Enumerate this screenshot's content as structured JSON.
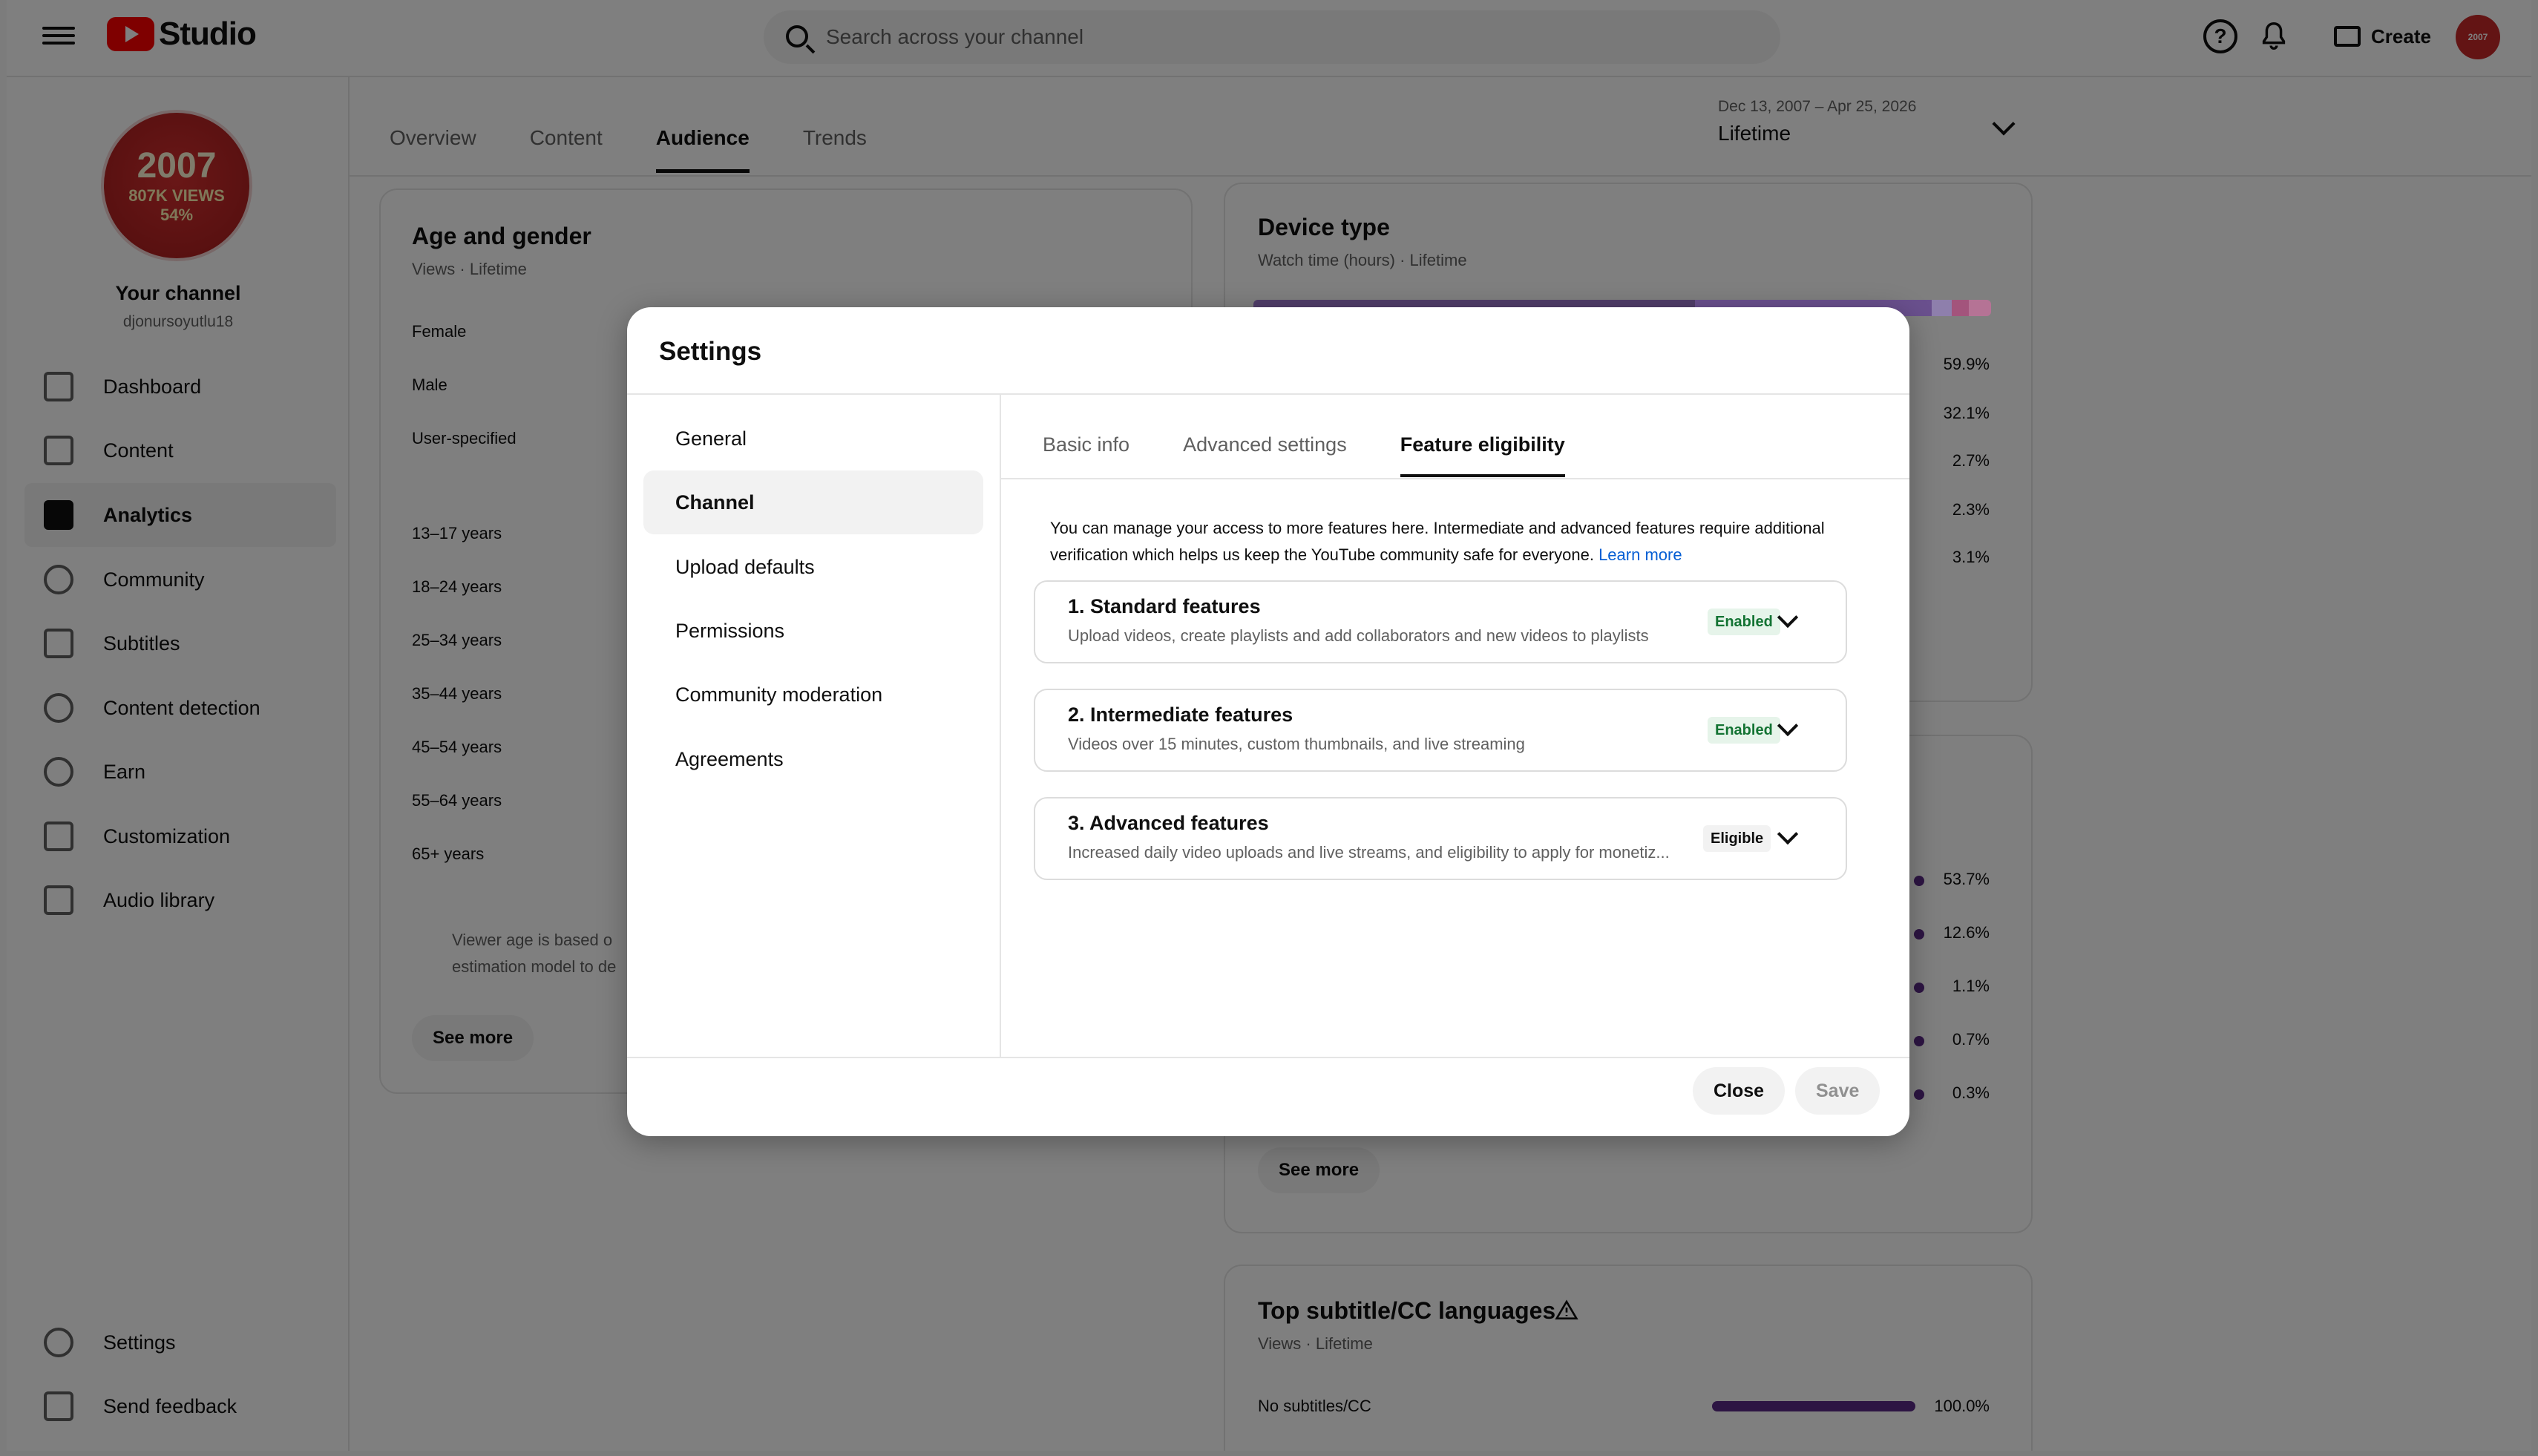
{
  "header": {
    "app_name": "Studio",
    "search_placeholder": "Search across your channel",
    "create_label": "Create",
    "avatar_text": "2007"
  },
  "sidebar": {
    "avatar": {
      "line1": "2007",
      "line2": "807K VIEWS",
      "line3": "54%"
    },
    "channel_name": "Your channel",
    "channel_handle": "djonursoyutlu18",
    "items": [
      {
        "label": "Dashboard",
        "icon": "dashboard-icon"
      },
      {
        "label": "Content",
        "icon": "content-icon"
      },
      {
        "label": "Analytics",
        "icon": "analytics-icon",
        "active": true
      },
      {
        "label": "Community",
        "icon": "community-icon"
      },
      {
        "label": "Subtitles",
        "icon": "subtitles-icon"
      },
      {
        "label": "Content detection",
        "icon": "copyright-icon"
      },
      {
        "label": "Earn",
        "icon": "dollar-icon"
      },
      {
        "label": "Customization",
        "icon": "magic-wand-icon"
      },
      {
        "label": "Audio library",
        "icon": "audio-library-icon"
      }
    ],
    "bottom": [
      {
        "label": "Settings",
        "icon": "gear-icon"
      },
      {
        "label": "Send feedback",
        "icon": "feedback-icon"
      }
    ]
  },
  "analytics": {
    "tabs": [
      "Overview",
      "Content",
      "Audience",
      "Trends"
    ],
    "active_tab": "Audience",
    "date_range": {
      "dates": "Dec 13, 2007 – Apr 25, 2026",
      "label": "Lifetime"
    },
    "age_gender": {
      "title": "Age and gender",
      "subtitle": "Views · Lifetime",
      "genders": [
        "Female",
        "Male",
        "User-specified"
      ],
      "ages": [
        "13–17 years",
        "18–24 years",
        "25–34 years",
        "35–44 years",
        "45–54 years",
        "55–64 years",
        "65+ years"
      ],
      "note": "Viewer age is based o",
      "note2": "estimation model to de",
      "see_more": "See more"
    },
    "device_type": {
      "title": "Device type",
      "subtitle": "Watch time (hours) · Lifetime",
      "percents": [
        "59.9%",
        "32.1%",
        "2.7%",
        "2.3%",
        "3.1%"
      ],
      "bar_colors": [
        "#2d0a5a",
        "#5a2a9c",
        "#9b7fd1",
        "#c2327a",
        "#e26aa8"
      ]
    },
    "second_card": {
      "percents": [
        "53.7%",
        "12.6%",
        "1.1%",
        "0.7%",
        "0.3%"
      ],
      "see_more": "See more"
    },
    "subtitle_langs": {
      "title": "Top subtitle/CC languages",
      "subtitle": "Views · Lifetime",
      "rows": [
        {
          "label": "No subtitles/CC",
          "value": "100.0%",
          "fraction": 1.0
        }
      ]
    }
  },
  "dialog": {
    "title": "Settings",
    "nav": [
      "General",
      "Channel",
      "Upload defaults",
      "Permissions",
      "Community moderation",
      "Agreements"
    ],
    "active_nav": "Channel",
    "tabs": [
      "Basic info",
      "Advanced settings",
      "Feature eligibility"
    ],
    "active_tab": "Feature eligibility",
    "intro": "You can manage your access to more features here. Intermediate and advanced features require additional verification which helps us keep the YouTube community safe for everyone.",
    "learn_more": "Learn more",
    "features": [
      {
        "title": "1. Standard features",
        "desc": "Upload videos, create playlists and add collaborators and new videos to playlists",
        "status": "Enabled"
      },
      {
        "title": "2. Intermediate features",
        "desc": "Videos over 15 minutes, custom thumbnails, and live streaming",
        "status": "Enabled"
      },
      {
        "title": "3. Advanced features",
        "desc": "Increased daily video uploads and live streams, and eligibility to apply for monetiz...",
        "status": "Eligible"
      }
    ],
    "close_label": "Close",
    "save_label": "Save"
  }
}
